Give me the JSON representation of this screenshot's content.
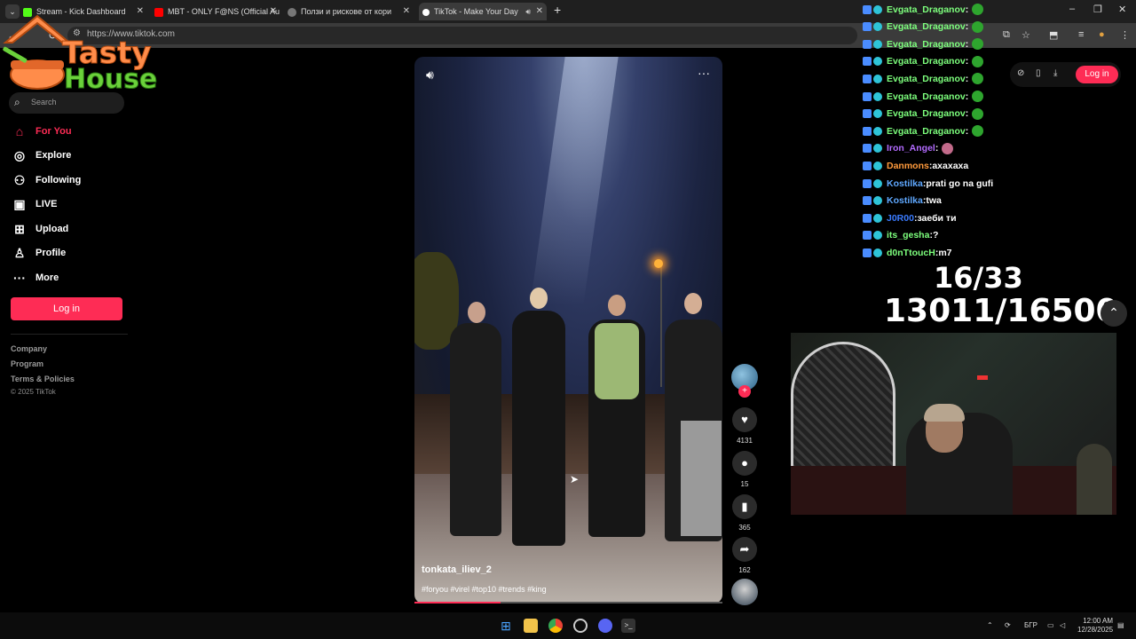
{
  "browser": {
    "tabs": [
      {
        "label": "Stream - Kick Dashboard",
        "favicon_color": "#53fc18"
      },
      {
        "label": "MBT - ONLY F@NS (Official Au",
        "favicon_color": "#ff0000"
      },
      {
        "label": "Ползи и рискове от кори",
        "favicon_color": "#888888"
      },
      {
        "label": "TikTok - Make Your Day",
        "favicon_color": "#ffffff"
      }
    ],
    "url": "https://www.tiktok.com"
  },
  "overlay_logo": {
    "line1": "Tasty",
    "line2": "House"
  },
  "sidebar": {
    "search_placeholder": "Search",
    "items": [
      {
        "label": "For You",
        "icon": "home-icon"
      },
      {
        "label": "Explore",
        "icon": "compass-icon"
      },
      {
        "label": "Following",
        "icon": "user-plus-icon"
      },
      {
        "label": "LIVE",
        "icon": "live-icon"
      },
      {
        "label": "Upload",
        "icon": "plus-square-icon"
      },
      {
        "label": "Profile",
        "icon": "user-icon"
      },
      {
        "label": "More",
        "icon": "ellipsis-icon"
      }
    ],
    "login_label": "Log in",
    "footer_links": [
      "Company",
      "Program",
      "Terms & Policies"
    ],
    "copyright": "© 2025 TikTok"
  },
  "video": {
    "username": "tonkata_iliev_2",
    "hashtags": "#foryou #virel #top10 #trends #king",
    "progress": 0.28,
    "actions": [
      {
        "name": "like",
        "icon": "heart-icon",
        "count": "4131"
      },
      {
        "name": "comment",
        "icon": "comment-icon",
        "count": "15"
      },
      {
        "name": "save",
        "icon": "bookmark-icon",
        "count": "365"
      },
      {
        "name": "share",
        "icon": "share-icon",
        "count": "162"
      }
    ]
  },
  "topbar": {
    "login_label": "Log in"
  },
  "chat": [
    {
      "user": "Evgata_Draganov",
      "msg": "",
      "color": "#7dff7d",
      "emote": "#2ea52e"
    },
    {
      "user": "Evgata_Draganov",
      "msg": "",
      "color": "#7dff7d",
      "emote": "#2ea52e"
    },
    {
      "user": "Evgata_Draganov",
      "msg": "",
      "color": "#7dff7d",
      "emote": "#2ea52e"
    },
    {
      "user": "Evgata_Draganov",
      "msg": "",
      "color": "#7dff7d",
      "emote": "#2ea52e"
    },
    {
      "user": "Evgata_Draganov",
      "msg": "",
      "color": "#7dff7d",
      "emote": "#2ea52e"
    },
    {
      "user": "Evgata_Draganov",
      "msg": "",
      "color": "#7dff7d",
      "emote": "#2ea52e"
    },
    {
      "user": "Evgata_Draganov",
      "msg": "",
      "color": "#7dff7d",
      "emote": "#2ea52e"
    },
    {
      "user": "Evgata_Draganov",
      "msg": "",
      "color": "#7dff7d",
      "emote": "#2ea52e"
    },
    {
      "user": "Iron_Angel",
      "msg": "",
      "color": "#b36bff",
      "emote": "#c26a8a"
    },
    {
      "user": "Danmons",
      "msg": "ахахаха",
      "color": "#ff9a3c",
      "emote": ""
    },
    {
      "user": "Kostilka",
      "msg": "prati go na gufi",
      "color": "#5fa8ff",
      "emote": ""
    },
    {
      "user": "Kostilka",
      "msg": "twa",
      "color": "#5fa8ff",
      "emote": ""
    },
    {
      "user": "J0R00",
      "msg": "заеби ти",
      "color": "#3a7bff",
      "emote": ""
    },
    {
      "user": "its_gesha",
      "msg": "?",
      "color": "#7dff7d",
      "emote": ""
    },
    {
      "user": "d0nTtoucH",
      "msg": "m7",
      "color": "#7dff7d",
      "emote": ""
    }
  ],
  "counters": {
    "line1": "16/33",
    "line2": "13011/16500"
  },
  "taskbar": {
    "lang": "БГР",
    "time": "12:00 AM",
    "date": "12/28/2025"
  }
}
